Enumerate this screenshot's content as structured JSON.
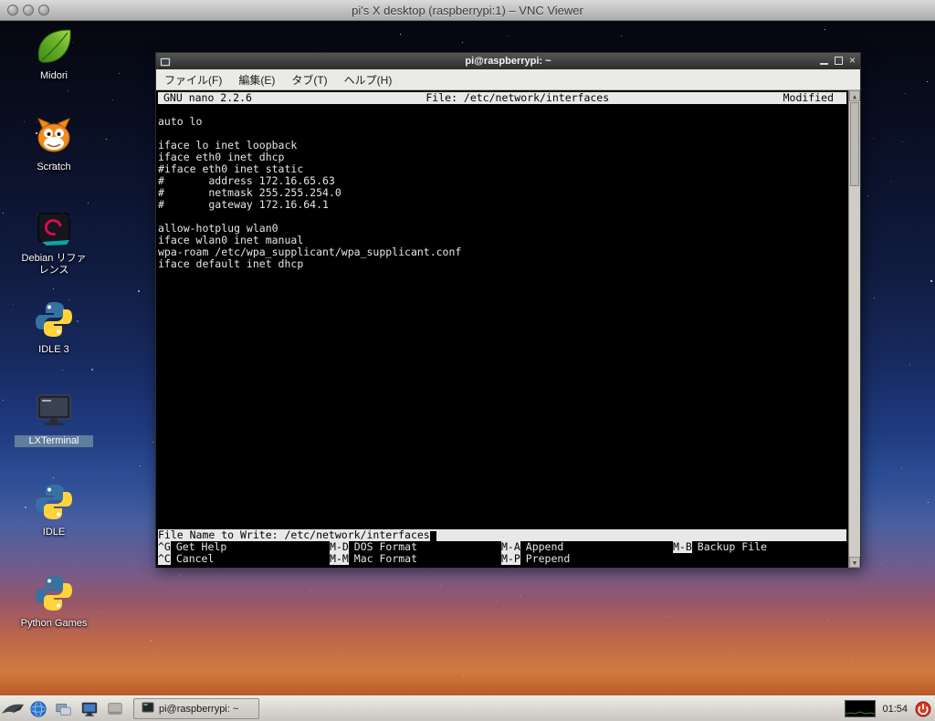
{
  "vnc_window": {
    "title": "pi's X desktop (raspberrypi:1) – VNC Viewer"
  },
  "desktop": {
    "icons": [
      {
        "label": "Midori"
      },
      {
        "label": "Scratch"
      },
      {
        "label": "Debian リファレンス"
      },
      {
        "label": "IDLE 3"
      },
      {
        "label": "LXTerminal"
      },
      {
        "label": "IDLE"
      },
      {
        "label": "Python Games"
      }
    ]
  },
  "terminal_window": {
    "title": "pi@raspberrypi: ~",
    "menu": [
      {
        "label": "ファイル(F)"
      },
      {
        "label": "編集(E)"
      },
      {
        "label": "タブ(T)"
      },
      {
        "label": "ヘルプ(H)"
      }
    ],
    "nano": {
      "app": "GNU nano 2.2.6",
      "file": "File: /etc/network/interfaces",
      "status": "Modified",
      "lines": [
        "",
        "auto lo",
        "",
        "iface lo inet loopback",
        "iface eth0 inet dhcp",
        "#iface eth0 inet static",
        "#       address 172.16.65.63",
        "#       netmask 255.255.254.0",
        "#       gateway 172.16.64.1",
        "",
        "allow-hotplug wlan0",
        "iface wlan0 inet manual",
        "wpa-roam /etc/wpa_supplicant/wpa_supplicant.conf",
        "iface default inet dhcp"
      ],
      "prompt": "File Name to Write: /etc/network/interfaces",
      "shortcuts_row1": [
        {
          "key": "^G",
          "label": "Get Help"
        },
        {
          "key": "M-D",
          "label": "DOS Format"
        },
        {
          "key": "M-A",
          "label": "Append"
        },
        {
          "key": "M-B",
          "label": "Backup File"
        }
      ],
      "shortcuts_row2": [
        {
          "key": "^C",
          "label": "Cancel"
        },
        {
          "key": "M-M",
          "label": "Mac Format"
        },
        {
          "key": "M-P",
          "label": "Prepend"
        }
      ]
    }
  },
  "taskbar": {
    "task_button": "pi@raspberrypi: ~",
    "clock": "01:54"
  },
  "colors": {
    "selection_blue": "#5f7d9c",
    "python_blue": "#3771a1",
    "python_yellow": "#ffd43b",
    "power_red": "#d23c2a"
  }
}
